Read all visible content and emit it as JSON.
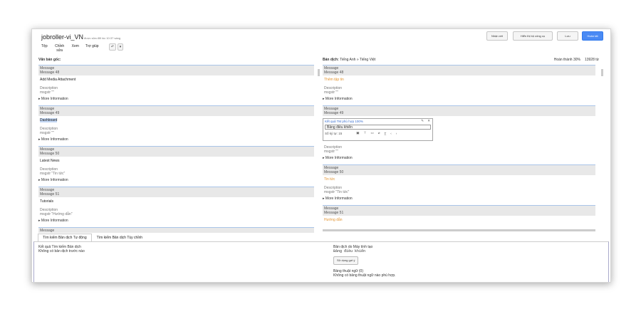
{
  "header": {
    "title": "jobroller-vi_VN",
    "saved_note": "được sửa đổi lúc 10:37 sáng",
    "menu": [
      "Tệp",
      "Chỉnh sửa",
      "Xem",
      "Trợ giúp"
    ],
    "buttons": {
      "assign": "Nhận xét",
      "show_toolkit": "Hiển thị bộ công cụ",
      "save": "Lưu",
      "finish": "Hoàn tất"
    }
  },
  "source_panel": {
    "heading": "Văn bản gốc:"
  },
  "target_panel": {
    "heading": "Bản dịch:",
    "langs": "Tiếng Anh » Tiếng Việt",
    "progress": "Hoàn thành 30%",
    "word_count": "13928 từ"
  },
  "labels": {
    "message": "Message",
    "description": "Description",
    "more_info": "More Information"
  },
  "source_items": [
    {
      "id": "Message 48",
      "text": "Add Media Attachment",
      "desc": "msgstr \"\""
    },
    {
      "id": "Message 49",
      "text": "Dashboard",
      "desc": "msgstr \"\""
    },
    {
      "id": "Message 50",
      "text": "Latest News",
      "desc": "msgstr \"Tin tức\""
    },
    {
      "id": "Message 51",
      "text": "Tutorials",
      "desc": "msgstr \"Hướng dẫn\""
    },
    {
      "id": "Message 52"
    }
  ],
  "target_items": [
    {
      "id": "Message 48",
      "text": "Thêm tập tin",
      "desc": "msgstr \"\""
    },
    {
      "id": "Message 49",
      "desc": "msgstr \"\""
    },
    {
      "id": "Message 50",
      "text": "Tin tức",
      "desc": "msgstr \"Tin tức\""
    },
    {
      "id": "Message 51",
      "text": "Hướng dẫn"
    }
  ],
  "editor": {
    "tm_match": "Kết quả TM phù hợp 100%",
    "value": "Bảng điều khiển",
    "char_count": "Số ký tự: 15"
  },
  "bottom": {
    "tabs": [
      "Tìm kiếm Bản dịch Tự động",
      "Tìm kiếm Bản dịch Tùy chỉnh"
    ],
    "search_results_title": "Kết quả Tìm kiếm Bản dịch",
    "no_prior": "Không có bản dịch trước nào",
    "mt_title": "Bản dịch do Máy tính tạo",
    "mt_value": "Bảng điều khiển",
    "use_button": "Sử dụng gợi ý",
    "glossary_title": "Bảng thuật ngữ (0)",
    "glossary_empty": "Không có bảng thuật ngữ nào phù hợp."
  }
}
